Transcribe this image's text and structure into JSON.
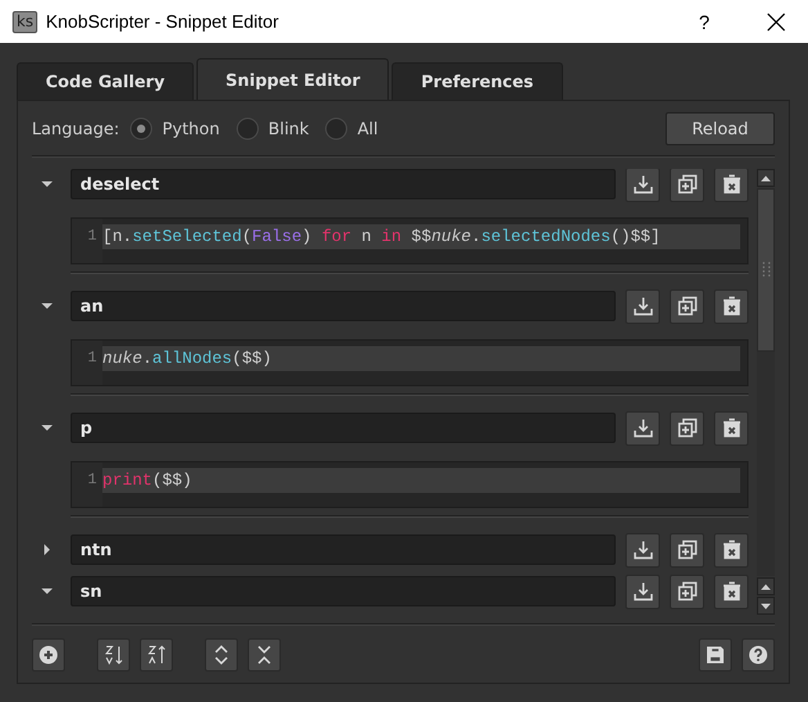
{
  "window": {
    "icon_text": "ks",
    "title": "KnobScripter - Snippet Editor",
    "help": "?"
  },
  "tabs": [
    {
      "label": "Code Gallery",
      "selected": false
    },
    {
      "label": "Snippet Editor",
      "selected": true
    },
    {
      "label": "Preferences",
      "selected": false
    }
  ],
  "language": {
    "label": "Language:",
    "options": [
      {
        "label": "Python",
        "selected": true
      },
      {
        "label": "Blink",
        "selected": false
      },
      {
        "label": "All",
        "selected": false
      }
    ]
  },
  "reload_button": "Reload",
  "snippets": [
    {
      "name": "deselect",
      "expanded": true,
      "lines": [
        {
          "number": "1",
          "tokens": [
            {
              "text": "[n.",
              "kind": "plain"
            },
            {
              "text": "setSelected",
              "kind": "method"
            },
            {
              "text": "(",
              "kind": "plain"
            },
            {
              "text": "False",
              "kind": "constant"
            },
            {
              "text": ") ",
              "kind": "plain"
            },
            {
              "text": "for",
              "kind": "keyword"
            },
            {
              "text": " n ",
              "kind": "plain"
            },
            {
              "text": "in",
              "kind": "keyword"
            },
            {
              "text": " $$",
              "kind": "plain"
            },
            {
              "text": "nuke",
              "kind": "module"
            },
            {
              "text": ".",
              "kind": "plain"
            },
            {
              "text": "selectedNodes",
              "kind": "method"
            },
            {
              "text": "()$$]",
              "kind": "plain"
            }
          ]
        }
      ]
    },
    {
      "name": "an",
      "expanded": true,
      "lines": [
        {
          "number": "1",
          "tokens": [
            {
              "text": "nuke",
              "kind": "module"
            },
            {
              "text": ".",
              "kind": "plain"
            },
            {
              "text": "allNodes",
              "kind": "method"
            },
            {
              "text": "($$)",
              "kind": "plain"
            }
          ]
        }
      ]
    },
    {
      "name": "p",
      "expanded": true,
      "lines": [
        {
          "number": "1",
          "tokens": [
            {
              "text": "print",
              "kind": "keyword"
            },
            {
              "text": "($$)",
              "kind": "plain"
            }
          ]
        }
      ]
    },
    {
      "name": "ntn",
      "expanded": false
    },
    {
      "name": "sn",
      "expanded": true
    }
  ]
}
